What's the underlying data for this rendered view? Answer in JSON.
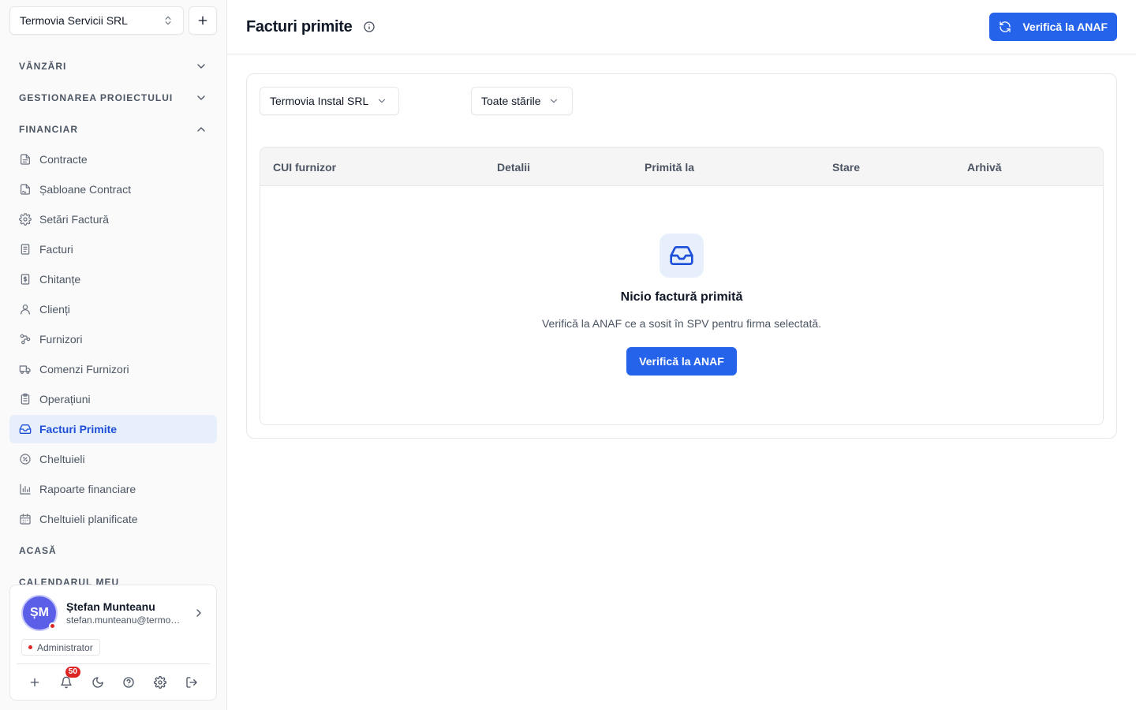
{
  "sidebar": {
    "company_select": {
      "value": "Termovia Servicii SRL",
      "icon": "chevrons-up-down-icon"
    },
    "add_company_icon": "plus-icon",
    "sections": {
      "vanzari": "VÂNZĂRI",
      "gestionare": "GESTIONAREA PROIECTULUI",
      "financiar": "FINANCIAR",
      "acasa": "ACASĂ",
      "calendar": "CALENDARUL MEU"
    },
    "items": [
      {
        "label": "Contracte",
        "icon": "file-text-icon"
      },
      {
        "label": "Șabloane Contract",
        "icon": "file-signature-icon"
      },
      {
        "label": "Setări Factură",
        "icon": "gear-icon"
      },
      {
        "label": "Facturi",
        "icon": "receipt-icon"
      },
      {
        "label": "Chitanțe",
        "icon": "dollar-receipt-icon"
      },
      {
        "label": "Clienți",
        "icon": "user-icon"
      },
      {
        "label": "Furnizori",
        "icon": "workflow-icon"
      },
      {
        "label": "Comenzi Furnizori",
        "icon": "truck-icon"
      },
      {
        "label": "Operațiuni",
        "icon": "clipboard-icon"
      },
      {
        "label": "Facturi Primite",
        "icon": "inbox-icon",
        "active": true
      },
      {
        "label": "Cheltuieli",
        "icon": "circle-slash-icon"
      },
      {
        "label": "Rapoarte financiare",
        "icon": "bar-chart-icon"
      },
      {
        "label": "Cheltuieli planificate",
        "icon": "calendar-icon"
      }
    ],
    "user": {
      "initials": "ȘM",
      "name": "Ștefan Munteanu",
      "email": "stefan.munteanu@termovia.ro",
      "role": "Administrator",
      "notifications": "50"
    }
  },
  "header": {
    "title": "Facturi primite",
    "verify_button": "Verifică la ANAF"
  },
  "filters": {
    "company": "Termovia Instal SRL",
    "status": "Toate stările"
  },
  "table": {
    "columns": [
      "CUI furnizor",
      "Detalii",
      "Primită la",
      "Stare",
      "Arhivă"
    ]
  },
  "empty_state": {
    "title": "Nicio factură primită",
    "description": "Verifică la ANAF ce a sosit în SPV pentru firma selectată.",
    "button": "Verifică la ANAF"
  },
  "colors": {
    "accent": "#2563eb",
    "active_bg": "#e8effc",
    "status_dot": "#dc2626"
  }
}
